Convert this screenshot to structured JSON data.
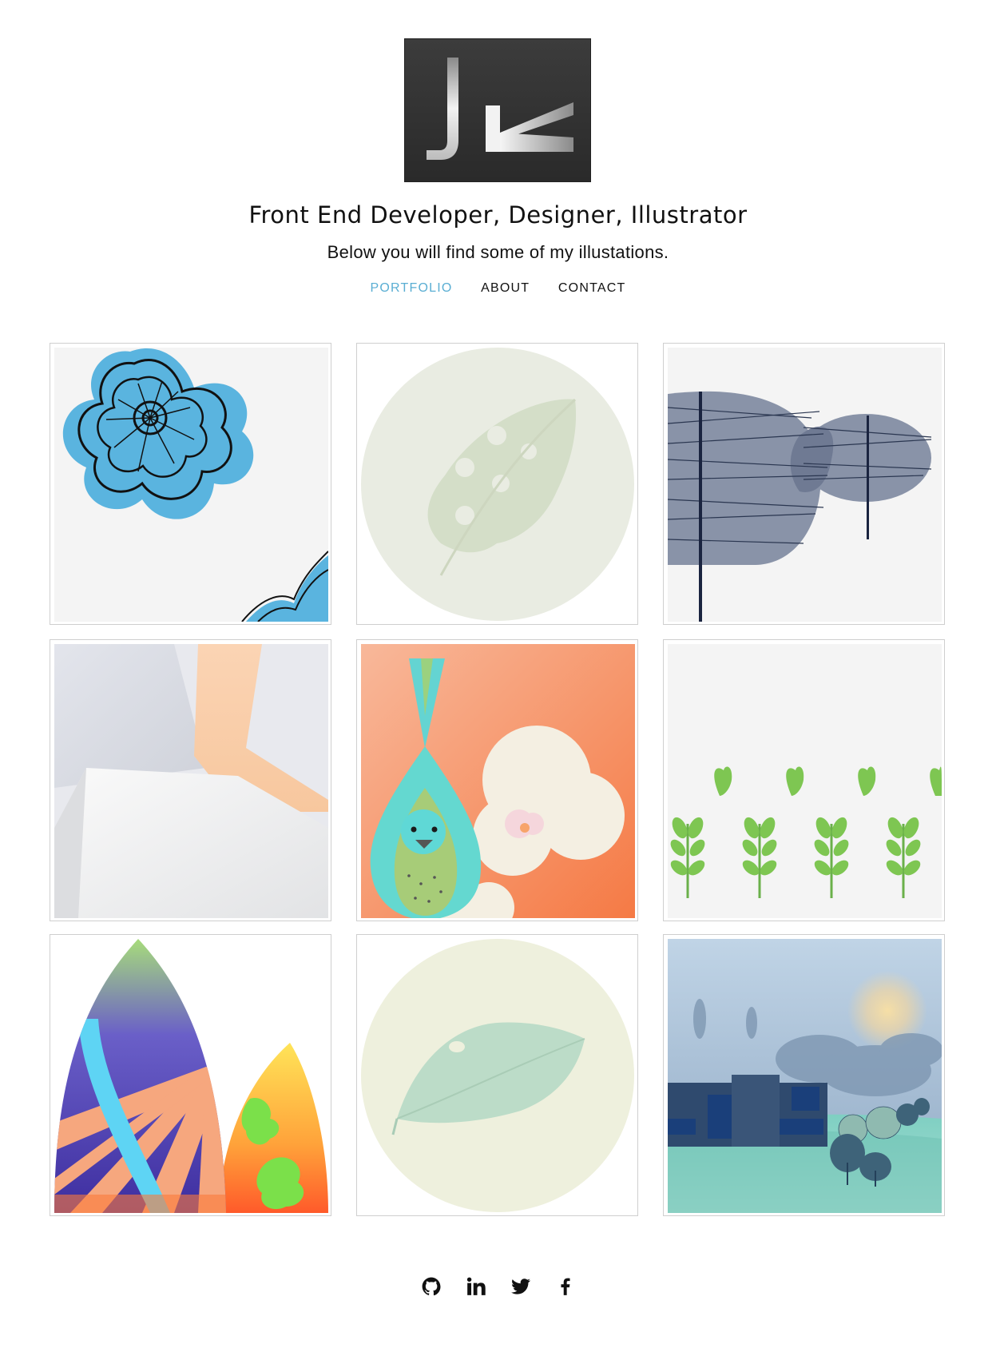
{
  "header": {
    "logo_text": "JK",
    "tagline": "Front End Developer, Designer, Illustrator",
    "intro": "Below you will find some of my illustations."
  },
  "nav": {
    "items": [
      {
        "label": "PORTFOLIO",
        "active": true
      },
      {
        "label": "ABOUT",
        "active": false
      },
      {
        "label": "CONTACT",
        "active": false
      }
    ],
    "active_color": "#5aaed3"
  },
  "portfolio": {
    "items": [
      {
        "subject": "blue-flower"
      },
      {
        "subject": "green-leaf-circle"
      },
      {
        "subject": "striped-trees"
      },
      {
        "subject": "geometric-shapes"
      },
      {
        "subject": "bird-orchid"
      },
      {
        "subject": "sprouts"
      },
      {
        "subject": "colorful-leaves"
      },
      {
        "subject": "teal-leaf-circle"
      },
      {
        "subject": "house-landscape"
      }
    ]
  },
  "social": {
    "icons": [
      "github-icon",
      "linkedin-icon",
      "twitter-icon",
      "facebook-icon"
    ]
  }
}
